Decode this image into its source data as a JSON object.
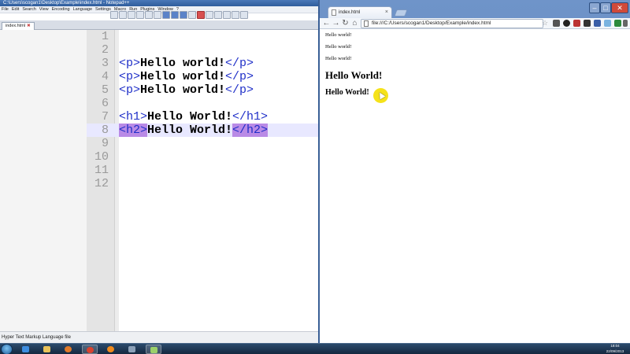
{
  "npp": {
    "title": "C:\\Users\\scogan1\\Desktop\\Example\\index.html - Notepad++",
    "menu": [
      "File",
      "Edit",
      "Search",
      "View",
      "Encoding",
      "Language",
      "Settings",
      "Macro",
      "Run",
      "Plugins",
      "Window",
      "?"
    ],
    "tab_label": "index.html",
    "status": "Hyper Text Markup Language file",
    "lines": [
      {
        "num": "1",
        "open": "",
        "text": "",
        "close": ""
      },
      {
        "num": "2",
        "open": "",
        "text": "",
        "close": ""
      },
      {
        "num": "3",
        "open": "<p>",
        "text": "Hello world!",
        "close": "</p>"
      },
      {
        "num": "4",
        "open": "<p>",
        "text": "Hello world!",
        "close": "</p>"
      },
      {
        "num": "5",
        "open": "<p>",
        "text": "Hello world!",
        "close": "</p>"
      },
      {
        "num": "6",
        "open": "",
        "text": "",
        "close": ""
      },
      {
        "num": "7",
        "open": "<h1>",
        "text": "Hello World!",
        "close": "</h1>"
      },
      {
        "num": "8",
        "open": "<h2>",
        "text": "Hello World!",
        "close": "</h2>"
      },
      {
        "num": "9",
        "open": "",
        "text": "",
        "close": ""
      },
      {
        "num": "10",
        "open": "",
        "text": "",
        "close": ""
      },
      {
        "num": "11",
        "open": "",
        "text": "",
        "close": ""
      },
      {
        "num": "12",
        "open": "",
        "text": "",
        "close": ""
      }
    ]
  },
  "chrome": {
    "tab_label": "index.html",
    "url": "file:///C:/Users/scogan1/Desktop/Example/index.html",
    "content": {
      "paragraphs": [
        "Hello world!",
        "Hello world!",
        "Hello world!"
      ],
      "h1": "Hello World!",
      "h2": "Hello World!"
    }
  },
  "taskbar": {
    "time": "18:04",
    "date": "22/09/2013"
  },
  "colors": {
    "tag_blue": "#1f2fc8",
    "tag_highlight": "#b98ae6",
    "current_line": "#e8e8ff",
    "cursor_highlight": "#f5e21a"
  }
}
